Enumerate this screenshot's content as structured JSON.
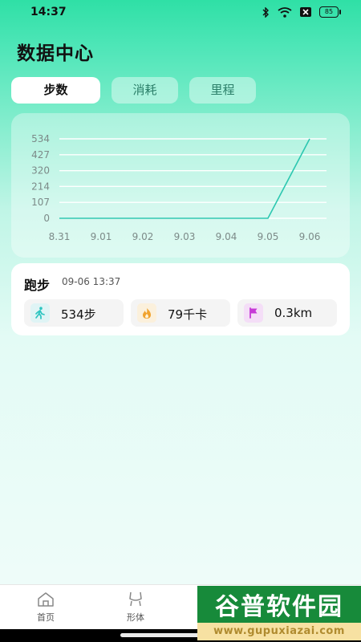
{
  "status_bar": {
    "time": "14:37",
    "battery": "85"
  },
  "page_title": "数据中心",
  "tabs": [
    {
      "label": "步数",
      "active": true
    },
    {
      "label": "消耗",
      "active": false
    },
    {
      "label": "里程",
      "active": false
    }
  ],
  "chart_data": {
    "type": "line",
    "categories": [
      "8.31",
      "9.01",
      "9.02",
      "9.03",
      "9.04",
      "9.05",
      "9.06"
    ],
    "values": [
      0,
      0,
      0,
      0,
      0,
      0,
      534
    ],
    "y_ticks": [
      "0",
      "107",
      "214",
      "320",
      "427",
      "534"
    ],
    "ylim": [
      0,
      534
    ],
    "grid": true,
    "line_color": "#2cc7b0"
  },
  "record": {
    "title": "跑步",
    "time": "09-06 13:37",
    "stats": [
      {
        "icon": "walking-person-icon",
        "value": "534步",
        "color": "#2cc4c0",
        "bg": "#dff4f5"
      },
      {
        "icon": "flame-icon",
        "value": "79千卡",
        "color": "#f0a330",
        "bg": "#fbf0dc"
      },
      {
        "icon": "flag-icon",
        "value": "0.3km",
        "color": "#c63ad6",
        "bg": "#f4def7"
      }
    ]
  },
  "nav": [
    {
      "label": "首页",
      "icon": "home-icon"
    },
    {
      "label": "形体",
      "icon": "body-icon"
    }
  ],
  "watermark": {
    "title": "谷普软件园",
    "url": "www.gupuxiazai.com"
  }
}
